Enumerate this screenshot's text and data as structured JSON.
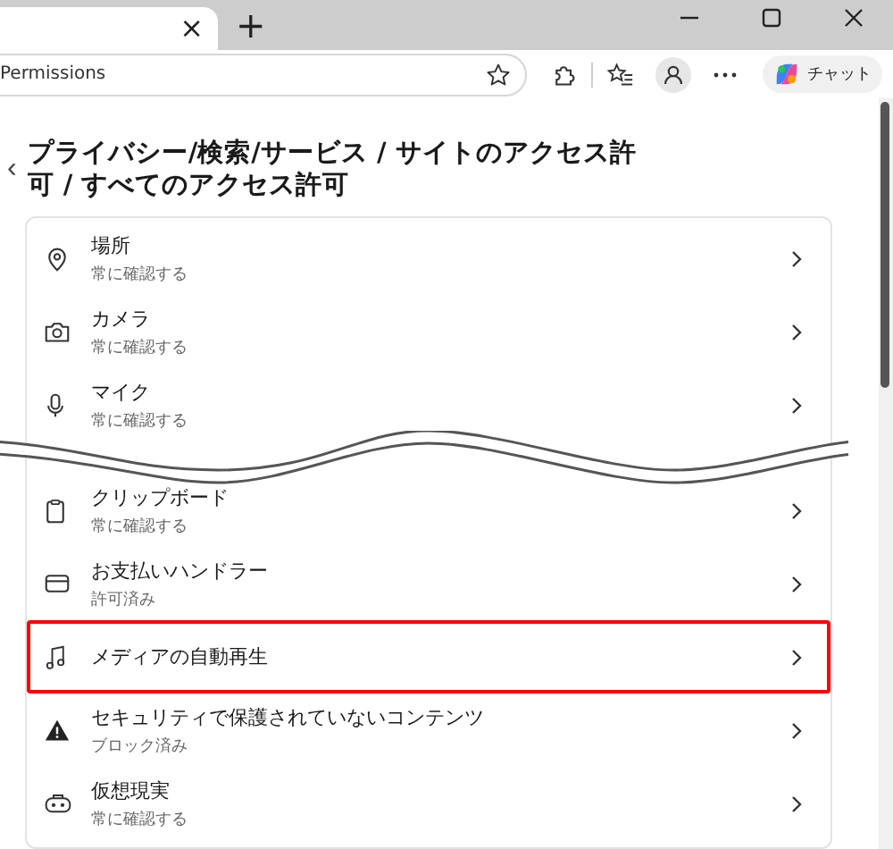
{
  "tab": {
    "close": "×"
  },
  "new_tab": "+",
  "address": {
    "value": "Permissions"
  },
  "copilot": {
    "label": "チャット"
  },
  "breadcrumb": {
    "back": "‹",
    "title": "プライバシー/検索/サービス / サイトのアクセス許可 / すべてのアクセス許可"
  },
  "items": [
    {
      "kind": "location",
      "title": "場所",
      "status": "常に確認する",
      "highlighted": false
    },
    {
      "kind": "camera",
      "title": "カメラ",
      "status": "常に確認する",
      "highlighted": false
    },
    {
      "kind": "mic",
      "title": "マイク",
      "status": "常に確認する",
      "highlighted": false
    },
    {
      "kind": "cut"
    },
    {
      "kind": "clipboard",
      "title": "クリップボード",
      "status": "常に確認する",
      "highlighted": false
    },
    {
      "kind": "payment",
      "title": "お支払いハンドラー",
      "status": "許可済み",
      "highlighted": false
    },
    {
      "kind": "media",
      "title": "メディアの自動再生",
      "highlighted": true
    },
    {
      "kind": "warning",
      "title": "セキュリティで保護されていないコンテンツ",
      "status": "ブロック済み",
      "highlighted": false
    },
    {
      "kind": "vr",
      "title": "仮想現実",
      "status": "常に確認する",
      "highlighted": false
    }
  ]
}
